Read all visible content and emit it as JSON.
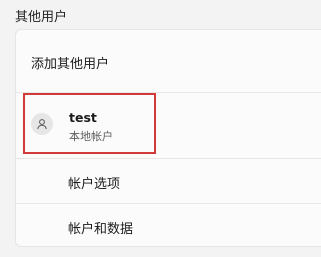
{
  "section": {
    "title": "其他用户"
  },
  "add_user": {
    "label": "添加其他用户"
  },
  "user": {
    "name": "test",
    "type": "本地帐户",
    "avatar_icon": "user-icon",
    "options": [
      {
        "label": "帐户选项"
      },
      {
        "label": "帐户和数据"
      }
    ]
  },
  "highlight_color": "#d23a3a"
}
